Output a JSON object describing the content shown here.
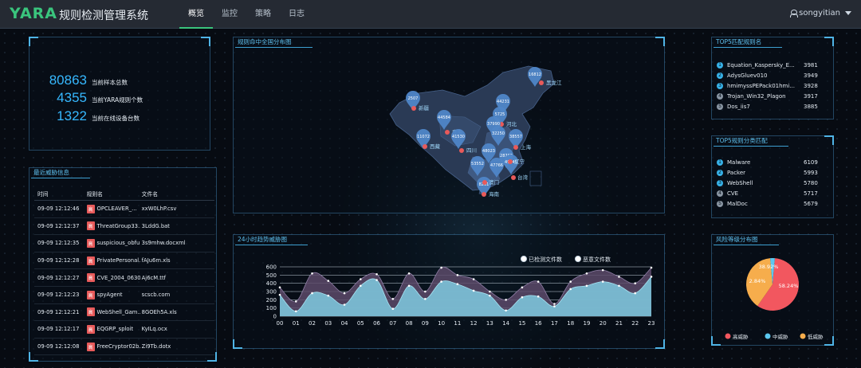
{
  "header": {
    "logo": "YARA",
    "title": "规则检测管理系统",
    "nav": [
      {
        "label": "概览",
        "active": true
      },
      {
        "label": "监控",
        "active": false
      },
      {
        "label": "策略",
        "active": false
      },
      {
        "label": "日志",
        "active": false
      }
    ],
    "username": "songyitian"
  },
  "stats": [
    {
      "value": "80863",
      "label": "当前样本总数"
    },
    {
      "value": "4355",
      "label": "当前YARA规则个数"
    },
    {
      "value": "1322",
      "label": "当前在线设备台数"
    }
  ],
  "threats": {
    "title": "最近威胁信息",
    "headers": {
      "time": "时间",
      "rule": "规则名",
      "file": "文件名"
    },
    "badge_label": "高",
    "rows": [
      {
        "time": "09-09 12:12:46",
        "rule": "OPCLEAVER_...",
        "file": "xxW0LhP.csv"
      },
      {
        "time": "09-09 12:12:37",
        "rule": "ThreatGroup33...",
        "file": "3LddG.bat"
      },
      {
        "time": "09-09 12:12:35",
        "rule": "suspicious_obfu...",
        "file": "3s9mhw.docxml"
      },
      {
        "time": "09-09 12:12:28",
        "rule": "PrivatePersonal...",
        "file": "fAJu6m.xls"
      },
      {
        "time": "09-09 12:12:27",
        "rule": "CVE_2004_0630",
        "file": "Aj6cM.ttf"
      },
      {
        "time": "09-09 12:12:23",
        "rule": "spyAgent",
        "file": "scscb.com"
      },
      {
        "time": "09-09 12:12:21",
        "rule": "WebShell_Gam...",
        "file": "8GOEh5A.xls"
      },
      {
        "time": "09-09 12:12:17",
        "rule": "EQGRP_sploit",
        "file": "KyILq.ocx"
      },
      {
        "time": "09-09 12:12:08",
        "rule": "FreeCryptor02b...",
        "file": "Zi9Tb.dotx"
      }
    ]
  },
  "map": {
    "title": "规则命中全国分布图",
    "pins": [
      {
        "value": "16812",
        "province": "黑龙江"
      },
      {
        "value": "2507",
        "province": "新疆"
      },
      {
        "value": "44231",
        "province": ""
      },
      {
        "value": "44584",
        "province": "青海"
      },
      {
        "value": "5725",
        "province": "河北"
      },
      {
        "value": "37990",
        "province": ""
      },
      {
        "value": "11072",
        "province": "西藏"
      },
      {
        "value": "41530",
        "province": "四川"
      },
      {
        "value": "32250",
        "province": ""
      },
      {
        "value": "38557",
        "province": "上海"
      },
      {
        "value": "48023",
        "province": ""
      },
      {
        "value": "28762",
        "province": ""
      },
      {
        "value": "49745",
        "province": ""
      },
      {
        "value": "53552",
        "province": ""
      },
      {
        "value": "47766",
        "province": ""
      },
      {
        "value": "8261",
        "province": "海南"
      }
    ],
    "extra_labels": [
      "台湾",
      "澳门",
      "辽宁"
    ]
  },
  "trend": {
    "title": "24小时趋势威胁图",
    "legend": [
      "已检测文件数",
      "恶意文件数"
    ]
  },
  "chart_data": {
    "type": "area",
    "title": "24小时趋势威胁图",
    "x": [
      "00",
      "01",
      "02",
      "03",
      "04",
      "05",
      "06",
      "07",
      "08",
      "09",
      "10",
      "11",
      "12",
      "13",
      "14",
      "15",
      "16",
      "17",
      "18",
      "19",
      "20",
      "21",
      "22",
      "23"
    ],
    "ylim": [
      0,
      600
    ],
    "yticks": [
      0,
      100,
      200,
      300,
      400,
      500,
      600
    ],
    "series": [
      {
        "name": "已检测文件数",
        "values": [
          350,
          180,
          520,
          430,
          280,
          450,
          510,
          210,
          520,
          300,
          590,
          500,
          450,
          300,
          200,
          350,
          420,
          150,
          420,
          520,
          560,
          480,
          400,
          590
        ]
      },
      {
        "name": "恶意文件数",
        "values": [
          260,
          60,
          280,
          250,
          140,
          370,
          440,
          90,
          370,
          210,
          420,
          390,
          310,
          250,
          70,
          230,
          240,
          120,
          330,
          370,
          420,
          370,
          280,
          480
        ]
      }
    ]
  },
  "top5_rules": {
    "title": "TOP5匹配规则名",
    "items": [
      {
        "rank": "1",
        "name": "Equation_Kaspersky_E...",
        "value": "3981"
      },
      {
        "rank": "2",
        "name": "AdysGluev010",
        "value": "3949"
      },
      {
        "rank": "3",
        "name": "hmimyssPEPack01hmi...",
        "value": "3928"
      },
      {
        "rank": "4",
        "name": "Trojan_Win32_Plagon",
        "value": "3917"
      },
      {
        "rank": "5",
        "name": "Dos_iis7",
        "value": "3885"
      }
    ]
  },
  "top5_categories": {
    "title": "TOP5规则分类匹配",
    "items": [
      {
        "rank": "1",
        "name": "Malware",
        "value": "6109"
      },
      {
        "rank": "2",
        "name": "Packer",
        "value": "5993"
      },
      {
        "rank": "3",
        "name": "WebShell",
        "value": "5780"
      },
      {
        "rank": "4",
        "name": "CVE",
        "value": "5717"
      },
      {
        "rank": "5",
        "name": "MalDoc",
        "value": "5679"
      }
    ]
  },
  "risk": {
    "title": "风险等级分布图",
    "slices": [
      {
        "label": "高威胁",
        "percent": 58.24,
        "text": "58.24%",
        "color": "#f2575f"
      },
      {
        "label": "中威胁",
        "percent": 2.84,
        "text": "2.84%",
        "color": "#5bc8f0"
      },
      {
        "label": "低威胁",
        "percent": 38.92,
        "text": "38.92%",
        "color": "#f6ad4c"
      }
    ]
  },
  "colors": {
    "accent": "#3ac47d",
    "blue": "#36b8ff",
    "badge": "#e85a5a",
    "rank_active": "#37b2e8",
    "rank_inactive": "#8a96a3"
  }
}
